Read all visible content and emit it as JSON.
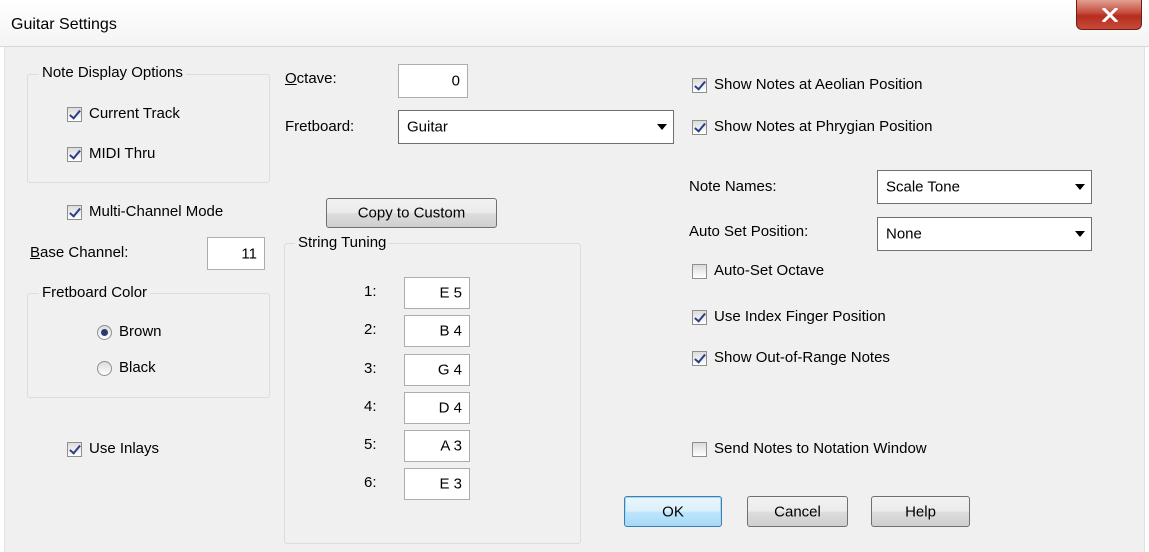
{
  "window": {
    "title": "Guitar Settings"
  },
  "note_display": {
    "legend": "Note Display Options",
    "current_track": {
      "label": "Current Track",
      "checked": true
    },
    "midi_thru": {
      "label": "MIDI Thru",
      "checked": true
    }
  },
  "multi_channel": {
    "label": "Multi-Channel Mode",
    "checked": true
  },
  "base_channel": {
    "label_prefix": "B",
    "label_rest": "ase Channel:",
    "value": "11"
  },
  "fretboard_color": {
    "legend": "Fretboard Color",
    "options": [
      "Brown",
      "Black"
    ],
    "selected": "Brown"
  },
  "use_inlays": {
    "label": "Use Inlays",
    "checked": true
  },
  "octave": {
    "label_prefix": "O",
    "label_rest": "ctave:",
    "value": "0"
  },
  "fretboard": {
    "label": "Fretboard:",
    "value": "Guitar"
  },
  "copy_to_custom": {
    "label": "Copy to Custom"
  },
  "string_tuning": {
    "legend": "String Tuning",
    "strings": [
      {
        "num": "1:",
        "value": "E 5"
      },
      {
        "num": "2:",
        "value": "B 4"
      },
      {
        "num": "3:",
        "value": "G 4"
      },
      {
        "num": "4:",
        "value": "D 4"
      },
      {
        "num": "5:",
        "value": "A 3"
      },
      {
        "num": "6:",
        "value": "E 3"
      }
    ]
  },
  "right": {
    "aeolian": {
      "label": "Show Notes at Aeolian Position",
      "checked": true
    },
    "phrygian": {
      "label": "Show Notes at Phrygian Position",
      "checked": true
    },
    "note_names": {
      "label": "Note Names:",
      "value": "Scale Tone"
    },
    "auto_set_position": {
      "label": "Auto Set Position:",
      "value": "None"
    },
    "auto_set_octave": {
      "label": "Auto-Set Octave",
      "checked": false
    },
    "index_finger": {
      "label": "Use Index Finger Position",
      "checked": true
    },
    "out_of_range": {
      "label": "Show Out-of-Range Notes",
      "checked": true
    },
    "send_notation": {
      "label": "Send Notes to Notation Window",
      "checked": false
    }
  },
  "buttons": {
    "ok": "OK",
    "cancel": "Cancel",
    "help": "Help"
  }
}
